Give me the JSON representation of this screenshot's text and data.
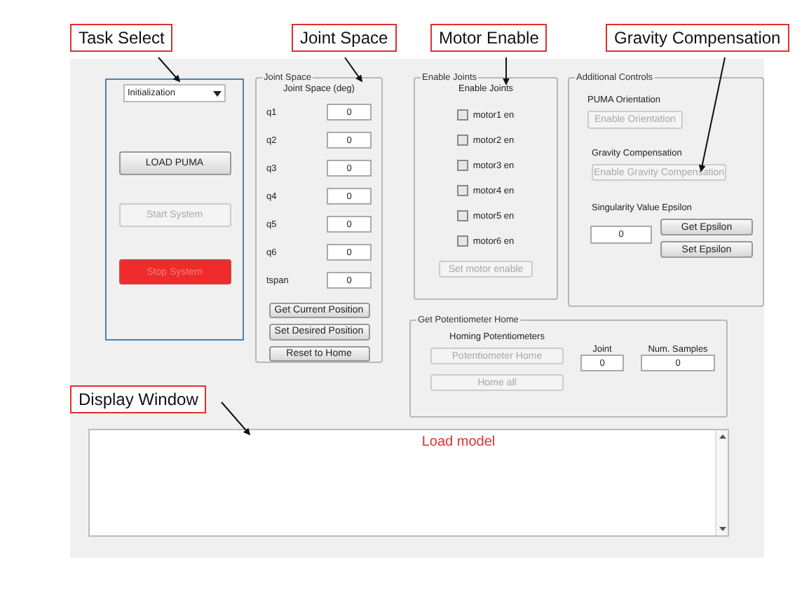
{
  "callouts": [
    {
      "label": "Task Select"
    },
    {
      "label": "Joint Space"
    },
    {
      "label": "Motor Enable"
    },
    {
      "label": "Gravity Compensation"
    },
    {
      "label": "Display Window"
    }
  ],
  "task_panel": {
    "dropdown": {
      "value": "Initialization"
    },
    "buttons": [
      {
        "label": "LOAD PUMA",
        "kind": "normal",
        "disabled": false
      },
      {
        "label": "Start System",
        "kind": "normal",
        "disabled": true
      },
      {
        "label": "Stop System",
        "kind": "danger",
        "disabled": true
      }
    ]
  },
  "joint_space": {
    "title": "Joint Space",
    "heading": "Joint  Space (deg)",
    "fields": [
      {
        "label": "q1",
        "value": "0"
      },
      {
        "label": "q2",
        "value": "0"
      },
      {
        "label": "q3",
        "value": "0"
      },
      {
        "label": "q4",
        "value": "0"
      },
      {
        "label": "q5",
        "value": "0"
      },
      {
        "label": "q6",
        "value": "0"
      },
      {
        "label": "tspan",
        "value": "0"
      }
    ],
    "buttons": [
      {
        "label": "Get Current Position",
        "disabled": false
      },
      {
        "label": "Set Desired Position",
        "disabled": false
      },
      {
        "label": "Reset to Home",
        "disabled": false
      }
    ]
  },
  "enable_joints": {
    "title": "Enable Joints",
    "heading": "Enable Joints",
    "motors": [
      {
        "label": "motor1 en",
        "checked": false
      },
      {
        "label": "motor2 en",
        "checked": false
      },
      {
        "label": "motor3 en",
        "checked": false
      },
      {
        "label": "motor4 en",
        "checked": false
      },
      {
        "label": "motor5 en",
        "checked": false
      },
      {
        "label": "motor6 en",
        "checked": false
      }
    ],
    "button": {
      "label": "Set motor enable",
      "disabled": true
    }
  },
  "additional_controls": {
    "title": "Additional Controls",
    "orientation": {
      "label": "PUMA Orientation",
      "button": {
        "label": "Enable Orientation",
        "disabled": true
      }
    },
    "gravity": {
      "label": "Gravity Compensation",
      "button": {
        "label": "Enable Gravity Compensation",
        "disabled": true
      }
    },
    "epsilon": {
      "label": "Singularity Value Epsilon",
      "value": "0",
      "buttons": [
        {
          "label": "Get Epsilon",
          "disabled": false
        },
        {
          "label": "Set Epsilon",
          "disabled": false
        }
      ]
    }
  },
  "potentiometer_home": {
    "title": "Get Potentiometer Home",
    "heading": "Homing Potentiometers",
    "buttons": [
      {
        "label": "Potentiometer Home",
        "disabled": true
      },
      {
        "label": "Home all",
        "disabled": true
      }
    ],
    "joint": {
      "label": "Joint",
      "value": "0"
    },
    "samples": {
      "label": "Num. Samples",
      "value": "0"
    }
  },
  "display": {
    "text": "Load model"
  }
}
